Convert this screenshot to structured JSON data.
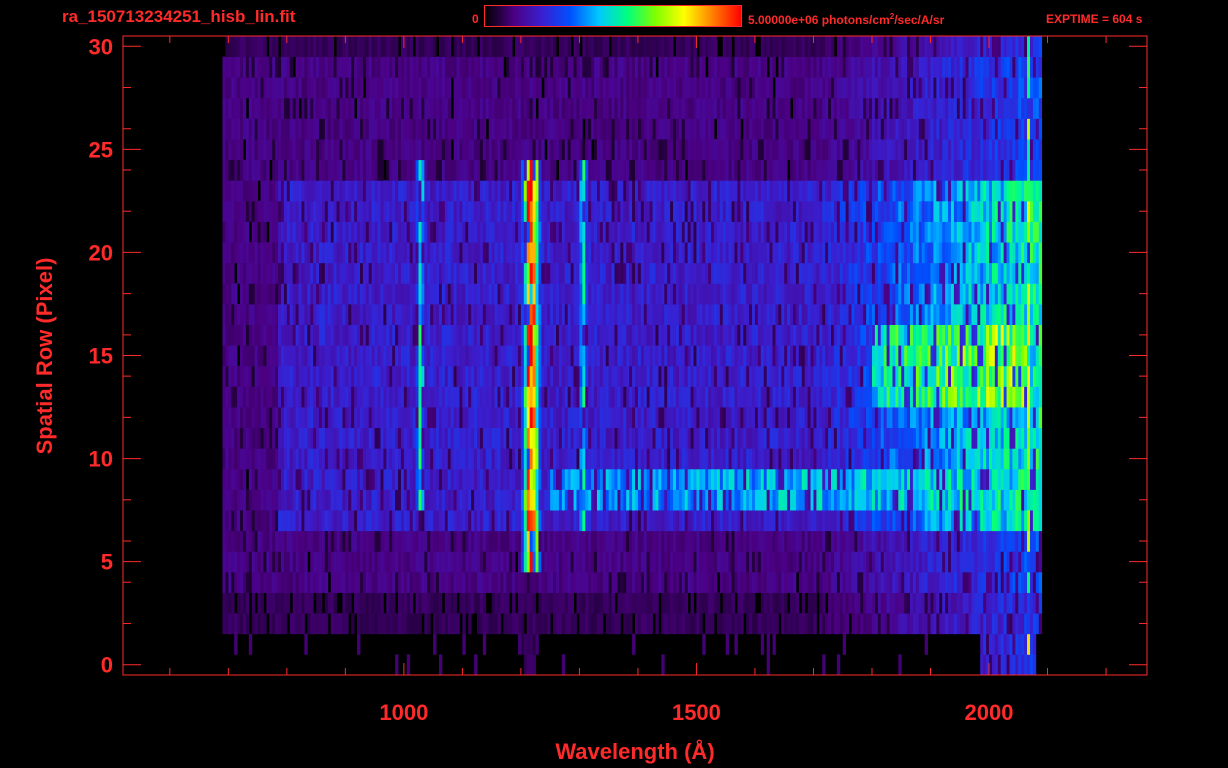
{
  "header": {
    "filename": "ra_150713234251_hisb_lin.fit",
    "colorbar_min_label": "0",
    "colorbar_max_label_main": "5.00000e+06 photons/cm",
    "colorbar_max_label_sup": "2",
    "colorbar_max_label_rest": "/sec/A/sr",
    "exptime_label": "EXPTIME = 604 s"
  },
  "colors": {
    "text": "#ff2a2a",
    "axes": "#ff2a2a",
    "background": "#000000",
    "colormap": [
      "#000000",
      "#4b0082",
      "#3a1fd0",
      "#0050ff",
      "#00c8ff",
      "#00ff80",
      "#80ff00",
      "#ffff00",
      "#ff8000",
      "#ff0000"
    ]
  },
  "chart_data": {
    "type": "heatmap",
    "title": "ra_150713234251_hisb_lin.fit",
    "xlabel": "Wavelength (Å)",
    "ylabel": "Spatial Row (Pixel)",
    "xlim": [
      520,
      2270
    ],
    "ylim": [
      -0.5,
      30.5
    ],
    "xticks": [
      1000,
      1500,
      2000
    ],
    "xtick_labels": [
      "1000",
      "1500",
      "2000"
    ],
    "yticks": [
      0,
      5,
      10,
      15,
      20,
      25,
      30
    ],
    "ytick_labels": [
      "0",
      "5",
      "10",
      "15",
      "20",
      "25",
      "30"
    ],
    "colorbar": {
      "min": 0,
      "max": 5000000,
      "units": "photons/cm^2/sec/A/sr"
    },
    "exptime_s": 604,
    "data_extent": {
      "x_min": 690,
      "x_max": 2090,
      "rows": [
        0,
        30
      ]
    },
    "features": [
      {
        "name": "emission line",
        "wavelength": 1215,
        "rows": [
          5,
          24
        ],
        "level": "peak"
      },
      {
        "name": "emission line",
        "wavelength": 1026,
        "rows": [
          8,
          24
        ],
        "level": "medium"
      },
      {
        "name": "emission line",
        "wavelength": 1304,
        "rows": [
          7,
          24
        ],
        "level": "medium"
      },
      {
        "name": "continuum",
        "wavelength_range": [
          1800,
          2060
        ],
        "rows": [
          13,
          16
        ],
        "level": "high"
      },
      {
        "name": "horizontal band",
        "wavelength_range": [
          1250,
          2060
        ],
        "rows": [
          8,
          9
        ],
        "level": "medium"
      },
      {
        "name": "detector edge",
        "wavelength": 2065,
        "rows": [
          1,
          30
        ],
        "level": "high"
      }
    ]
  }
}
